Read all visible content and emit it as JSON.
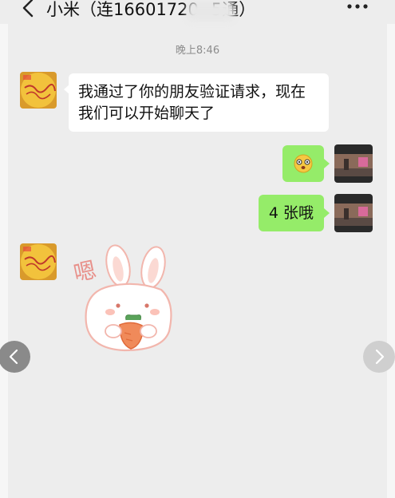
{
  "header": {
    "title": "小米（连16601720",
    "title_suffix": "5通）",
    "back_icon": "chevron-left-icon",
    "more_icon": "more-dots-icon"
  },
  "chat": {
    "timestamp": "晚上8:46",
    "messages": [
      {
        "side": "left",
        "type": "text",
        "text_line1": "我通过了你的朋友验证请求，现在",
        "text_line2": "我们可以开始聊天了"
      },
      {
        "side": "right",
        "type": "emoji",
        "emoji": "😵"
      },
      {
        "side": "right",
        "type": "text",
        "text": "4 张哦"
      },
      {
        "side": "left",
        "type": "sticker",
        "sticker_text": "嗯"
      }
    ]
  },
  "colors": {
    "background": "#ededed",
    "bubble_green": "#95ec69",
    "bubble_white": "#ffffff"
  }
}
